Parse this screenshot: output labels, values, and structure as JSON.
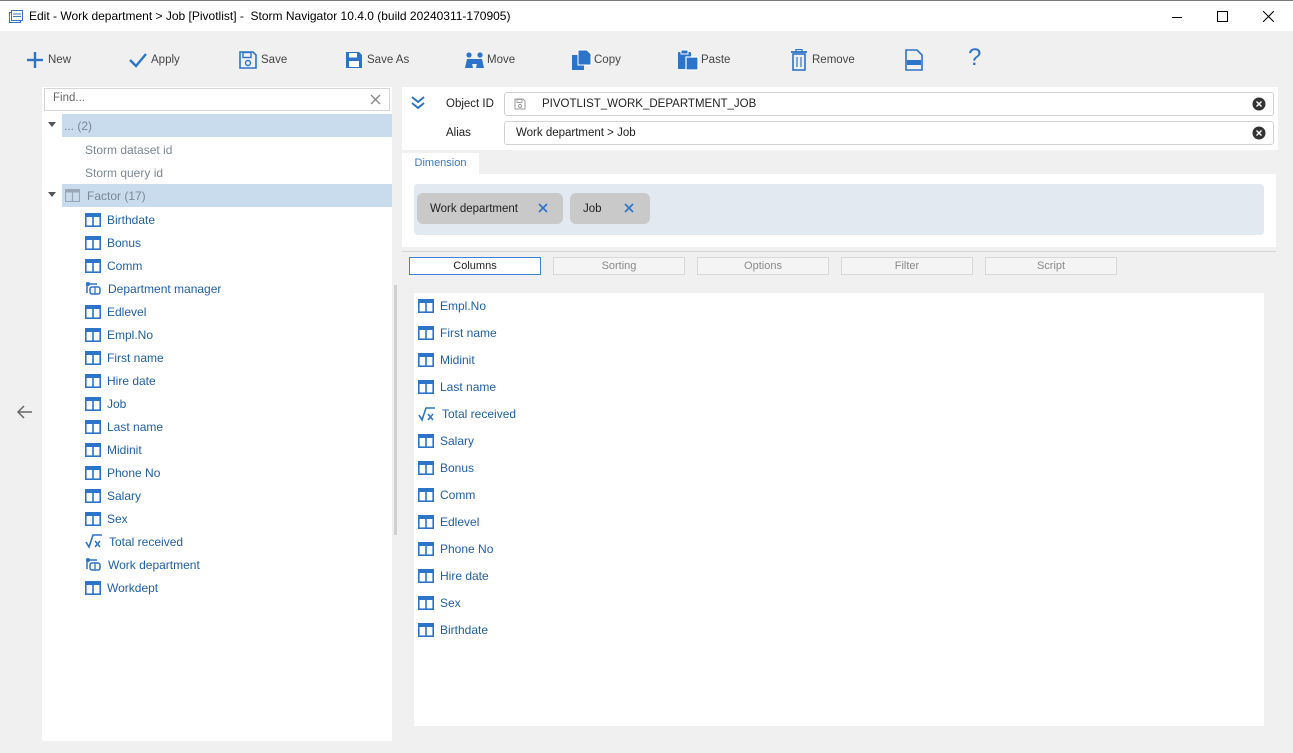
{
  "window": {
    "title": "Edit - Work department > Job [Pivotlist] -  Storm Navigator 10.4.0 (build 20240311-170905)"
  },
  "toolbar": {
    "new": "New",
    "apply": "Apply",
    "save": "Save",
    "save_as": "Save As",
    "move": "Move",
    "copy": "Copy",
    "paste": "Paste",
    "remove": "Remove",
    "help": "?"
  },
  "left": {
    "search_placeholder": "Find...",
    "groups": [
      {
        "label": "... (2)",
        "children": [
          "Storm dataset id",
          "Storm query id"
        ]
      },
      {
        "label": "Factor (17)"
      }
    ],
    "items": [
      {
        "label": "Birthdate",
        "icon": "column-icon"
      },
      {
        "label": "Bonus",
        "icon": "column-icon"
      },
      {
        "label": "Comm",
        "icon": "column-icon"
      },
      {
        "label": "Department manager",
        "icon": "link-column-icon"
      },
      {
        "label": "Edlevel",
        "icon": "column-icon"
      },
      {
        "label": "Empl.No",
        "icon": "column-icon"
      },
      {
        "label": "First name",
        "icon": "column-icon"
      },
      {
        "label": "Hire date",
        "icon": "column-icon"
      },
      {
        "label": "Job",
        "icon": "column-icon"
      },
      {
        "label": "Last name",
        "icon": "column-icon"
      },
      {
        "label": "Midinit",
        "icon": "column-icon"
      },
      {
        "label": "Phone No",
        "icon": "column-icon"
      },
      {
        "label": "Salary",
        "icon": "column-icon"
      },
      {
        "label": "Sex",
        "icon": "column-icon"
      },
      {
        "label": "Total received",
        "icon": "formula-icon"
      },
      {
        "label": "Work department",
        "icon": "link-column-icon"
      },
      {
        "label": "Workdept",
        "icon": "column-icon"
      }
    ]
  },
  "object": {
    "id_label": "Object ID",
    "id_value": "PIVOTLIST_WORK_DEPARTMENT_JOB",
    "alias_label": "Alias",
    "alias_value": "Work department > Job"
  },
  "dimension": {
    "tab_label": "Dimension",
    "chips": [
      "Work department",
      "Job"
    ]
  },
  "tabs": [
    "Columns",
    "Sorting",
    "Options",
    "Filter",
    "Script"
  ],
  "columns": [
    {
      "label": "Empl.No",
      "icon": "column-icon"
    },
    {
      "label": "First name",
      "icon": "column-icon"
    },
    {
      "label": "Midinit",
      "icon": "column-icon"
    },
    {
      "label": "Last name",
      "icon": "column-icon"
    },
    {
      "label": "Total received",
      "icon": "formula-icon"
    },
    {
      "label": "Salary",
      "icon": "column-icon"
    },
    {
      "label": "Bonus",
      "icon": "column-icon"
    },
    {
      "label": "Comm",
      "icon": "column-icon"
    },
    {
      "label": "Edlevel",
      "icon": "column-icon"
    },
    {
      "label": "Phone No",
      "icon": "column-icon"
    },
    {
      "label": "Hire date",
      "icon": "column-icon"
    },
    {
      "label": "Sex",
      "icon": "column-icon"
    },
    {
      "label": "Birthdate",
      "icon": "column-icon"
    }
  ],
  "colors": {
    "accent": "#3a86d6",
    "link": "#1f5fa6",
    "icon": "#2c74c9",
    "selection": "#c8dcee"
  }
}
